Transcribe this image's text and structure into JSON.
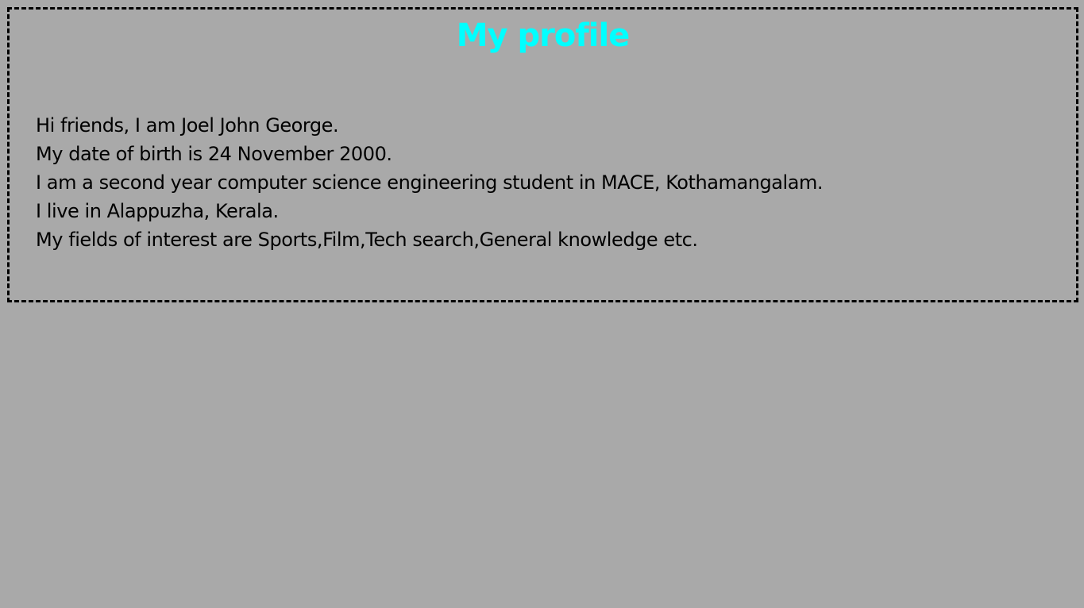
{
  "profile": {
    "title": "My profile",
    "lines": [
      "Hi friends, I am Joel John George.",
      "My date of birth is 24 November 2000.",
      "I am a second year computer science engineering student in MACE, Kothamangalam.",
      "I live in Alappuzha, Kerala.",
      "My fields of interest are Sports,Film,Tech search,General knowledge etc."
    ]
  },
  "colors": {
    "page_background": "#a9a9a9",
    "title_text": "#00ffff",
    "body_text": "#000000",
    "border": "#000000"
  }
}
